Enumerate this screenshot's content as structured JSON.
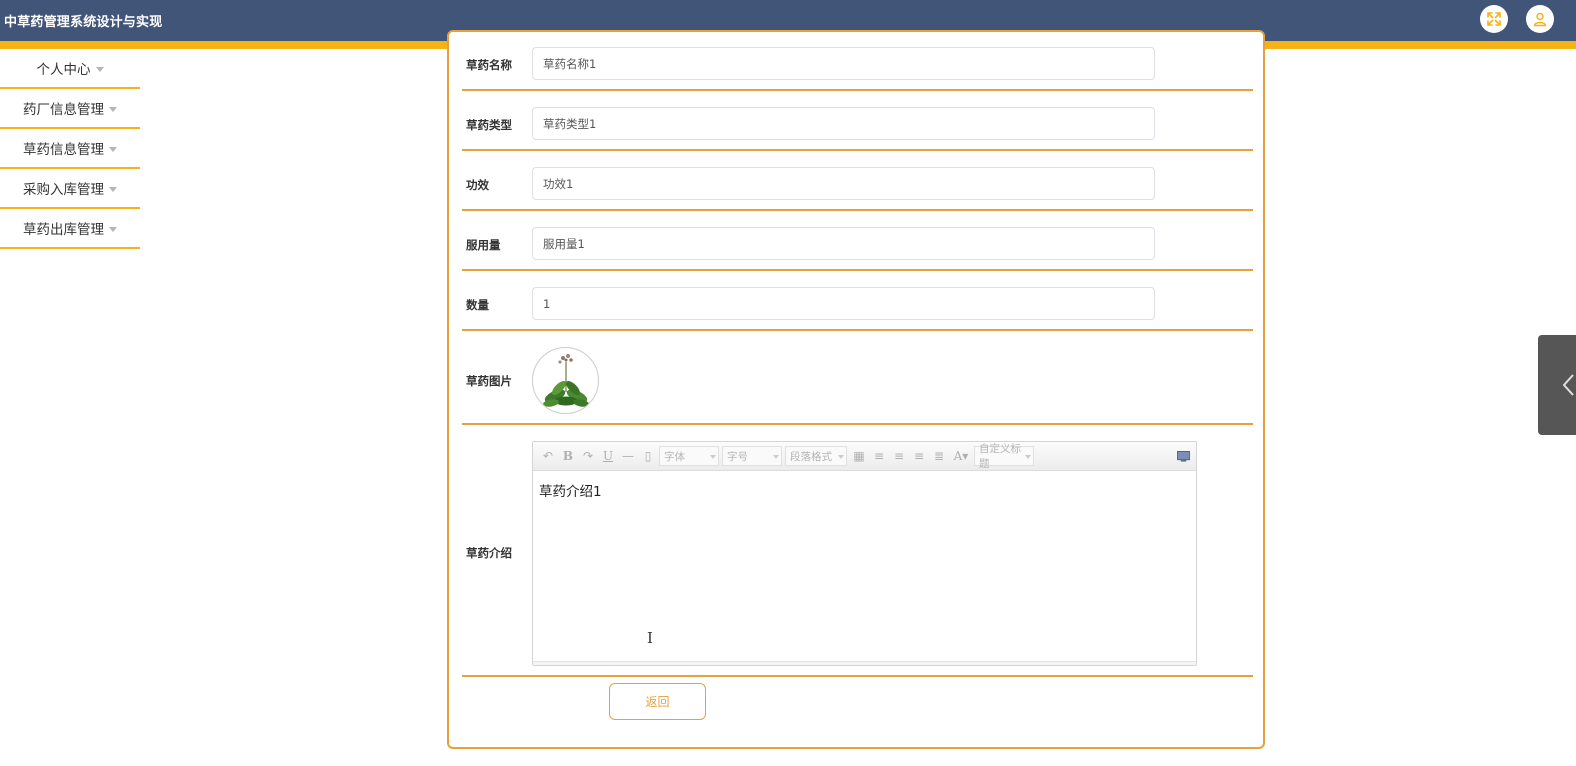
{
  "header": {
    "title": "中草药管理系统设计与实现",
    "fullscreen_icon": "fullscreen-icon",
    "user_icon": "user-icon"
  },
  "sidebar": {
    "items": [
      {
        "label": "个人中心"
      },
      {
        "label": "药厂信息管理"
      },
      {
        "label": "草药信息管理"
      },
      {
        "label": "采购入库管理"
      },
      {
        "label": "草药出库管理"
      }
    ]
  },
  "form": {
    "fields": [
      {
        "label": "草药名称",
        "value": "草药名称1"
      },
      {
        "label": "草药类型",
        "value": "草药类型1"
      },
      {
        "label": "功效",
        "value": "功效1"
      },
      {
        "label": "服用量",
        "value": "服用量1"
      },
      {
        "label": "数量",
        "value": "1"
      }
    ],
    "image_label": "草药图片",
    "intro_label": "草药介绍",
    "intro_value": "草药介绍1",
    "back_label": "返回"
  },
  "editor": {
    "toolbar": {
      "font_family": "字体",
      "font_size": "字号",
      "paragraph": "段落格式",
      "custom_title": "自定义标题"
    }
  },
  "colors": {
    "header_bg": "#415579",
    "accent": "#f5b316",
    "border": "#e8a03c"
  }
}
